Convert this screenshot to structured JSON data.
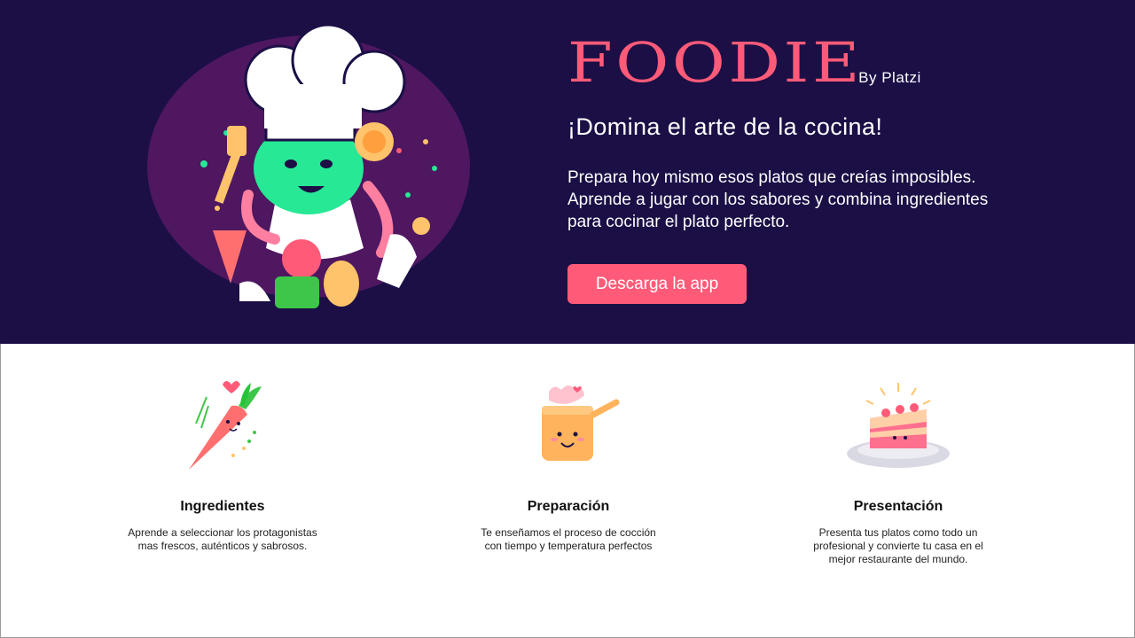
{
  "hero": {
    "brand": "FOODIE",
    "by_line": "By Platzi",
    "heading": "¡Domina el arte de la cocina!",
    "copy": "Prepara hoy mismo esos platos que creías imposibles. Aprende a jugar con los sabores y combina ingredientes para cocinar el plato perfecto.",
    "cta_label": "Descarga la app"
  },
  "features": [
    {
      "icon": "carrot-icon",
      "title": "Ingredientes",
      "description": "Aprende a seleccionar los protagonistas mas frescos, auténticos y sabrosos."
    },
    {
      "icon": "cooking-pot-icon",
      "title": "Preparación",
      "description": "Te enseñamos el proceso de cocción con tiempo y temperatura perfectos"
    },
    {
      "icon": "cake-plate-icon",
      "title": "Presentación",
      "description": "Presenta tus platos como todo un profesional y convierte tu casa en el mejor restaurante del mundo."
    }
  ],
  "colors": {
    "hero_background": "#1b0f46",
    "accent": "#ff5b78",
    "illustration_blob": "#4e1760",
    "chef_green": "#27e894"
  }
}
